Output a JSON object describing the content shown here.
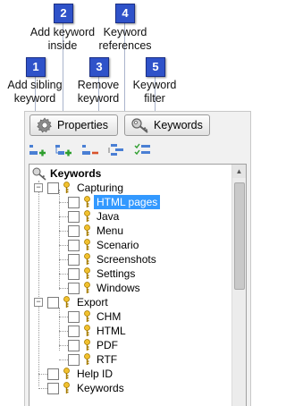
{
  "callouts": [
    {
      "number": "1",
      "caption_line1": "Add sibling",
      "caption_line2": "keyword"
    },
    {
      "number": "2",
      "caption_line1": "Add keyword",
      "caption_line2": "inside"
    },
    {
      "number": "3",
      "caption_line1": "Remove",
      "caption_line2": "keyword"
    },
    {
      "number": "4",
      "caption_line1": "Keyword",
      "caption_line2": "references"
    },
    {
      "number": "5",
      "caption_line1": "Keyword",
      "caption_line2": "filter"
    }
  ],
  "tabs": {
    "properties": "Properties",
    "keywords": "Keywords"
  },
  "tree": {
    "root": "Keywords",
    "capturing": "Capturing",
    "capturing_children": [
      "HTML pages",
      "Java",
      "Menu",
      "Scenario",
      "Screenshots",
      "Settings",
      "Windows"
    ],
    "export": "Export",
    "export_children": [
      "CHM",
      "HTML",
      "PDF",
      "RTF"
    ],
    "help_id": "Help ID",
    "keywords_item": "Keywords",
    "selected": "HTML pages"
  },
  "colors": {
    "callout": "#2f52c9",
    "selection": "#3399ff"
  }
}
